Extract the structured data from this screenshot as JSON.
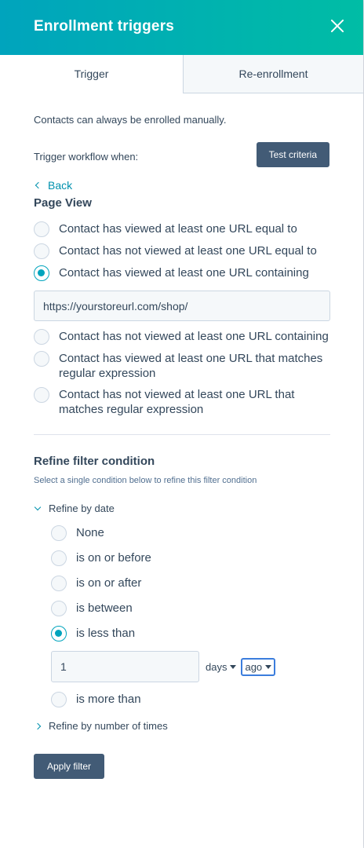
{
  "header": {
    "title": "Enrollment triggers"
  },
  "tabs": [
    {
      "label": "Trigger",
      "active": true
    },
    {
      "label": "Re-enrollment",
      "active": false
    }
  ],
  "manual_note": "Contacts can always be enrolled manually.",
  "trigger_label": "Trigger workflow when:",
  "test_criteria_label": "Test criteria",
  "back_label": "Back",
  "section_title": "Page View",
  "url_options": [
    {
      "label": "Contact has viewed at least one URL equal to",
      "checked": false
    },
    {
      "label": "Contact has not viewed at least one URL equal to",
      "checked": false
    },
    {
      "label": "Contact has viewed at least one URL containing",
      "checked": true
    },
    {
      "label": "Contact has not viewed at least one URL containing",
      "checked": false
    },
    {
      "label": "Contact has viewed at least one URL that matches regular expression",
      "checked": false
    },
    {
      "label": "Contact has not viewed at least one URL that matches regular expression",
      "checked": false
    }
  ],
  "url_value": "https://yourstoreurl.com/shop/",
  "refine": {
    "title": "Refine filter condition",
    "subtitle": "Select a single condition below to refine this filter condition",
    "by_date_label": "Refine by date",
    "date_options": [
      {
        "label": "None",
        "checked": false
      },
      {
        "label": "is on or before",
        "checked": false
      },
      {
        "label": "is on or after",
        "checked": false
      },
      {
        "label": "is between",
        "checked": false
      },
      {
        "label": "is less than",
        "checked": true
      },
      {
        "label": "is more than",
        "checked": false
      }
    ],
    "less_than_value": "1",
    "unit_value": "days",
    "direction_value": "ago",
    "by_times_label": "Refine by number of times"
  },
  "apply_label": "Apply filter",
  "colors": {
    "header_start": "#00a4bd",
    "header_end": "#00bda5",
    "accent": "#00a4bd",
    "button": "#425b76"
  }
}
